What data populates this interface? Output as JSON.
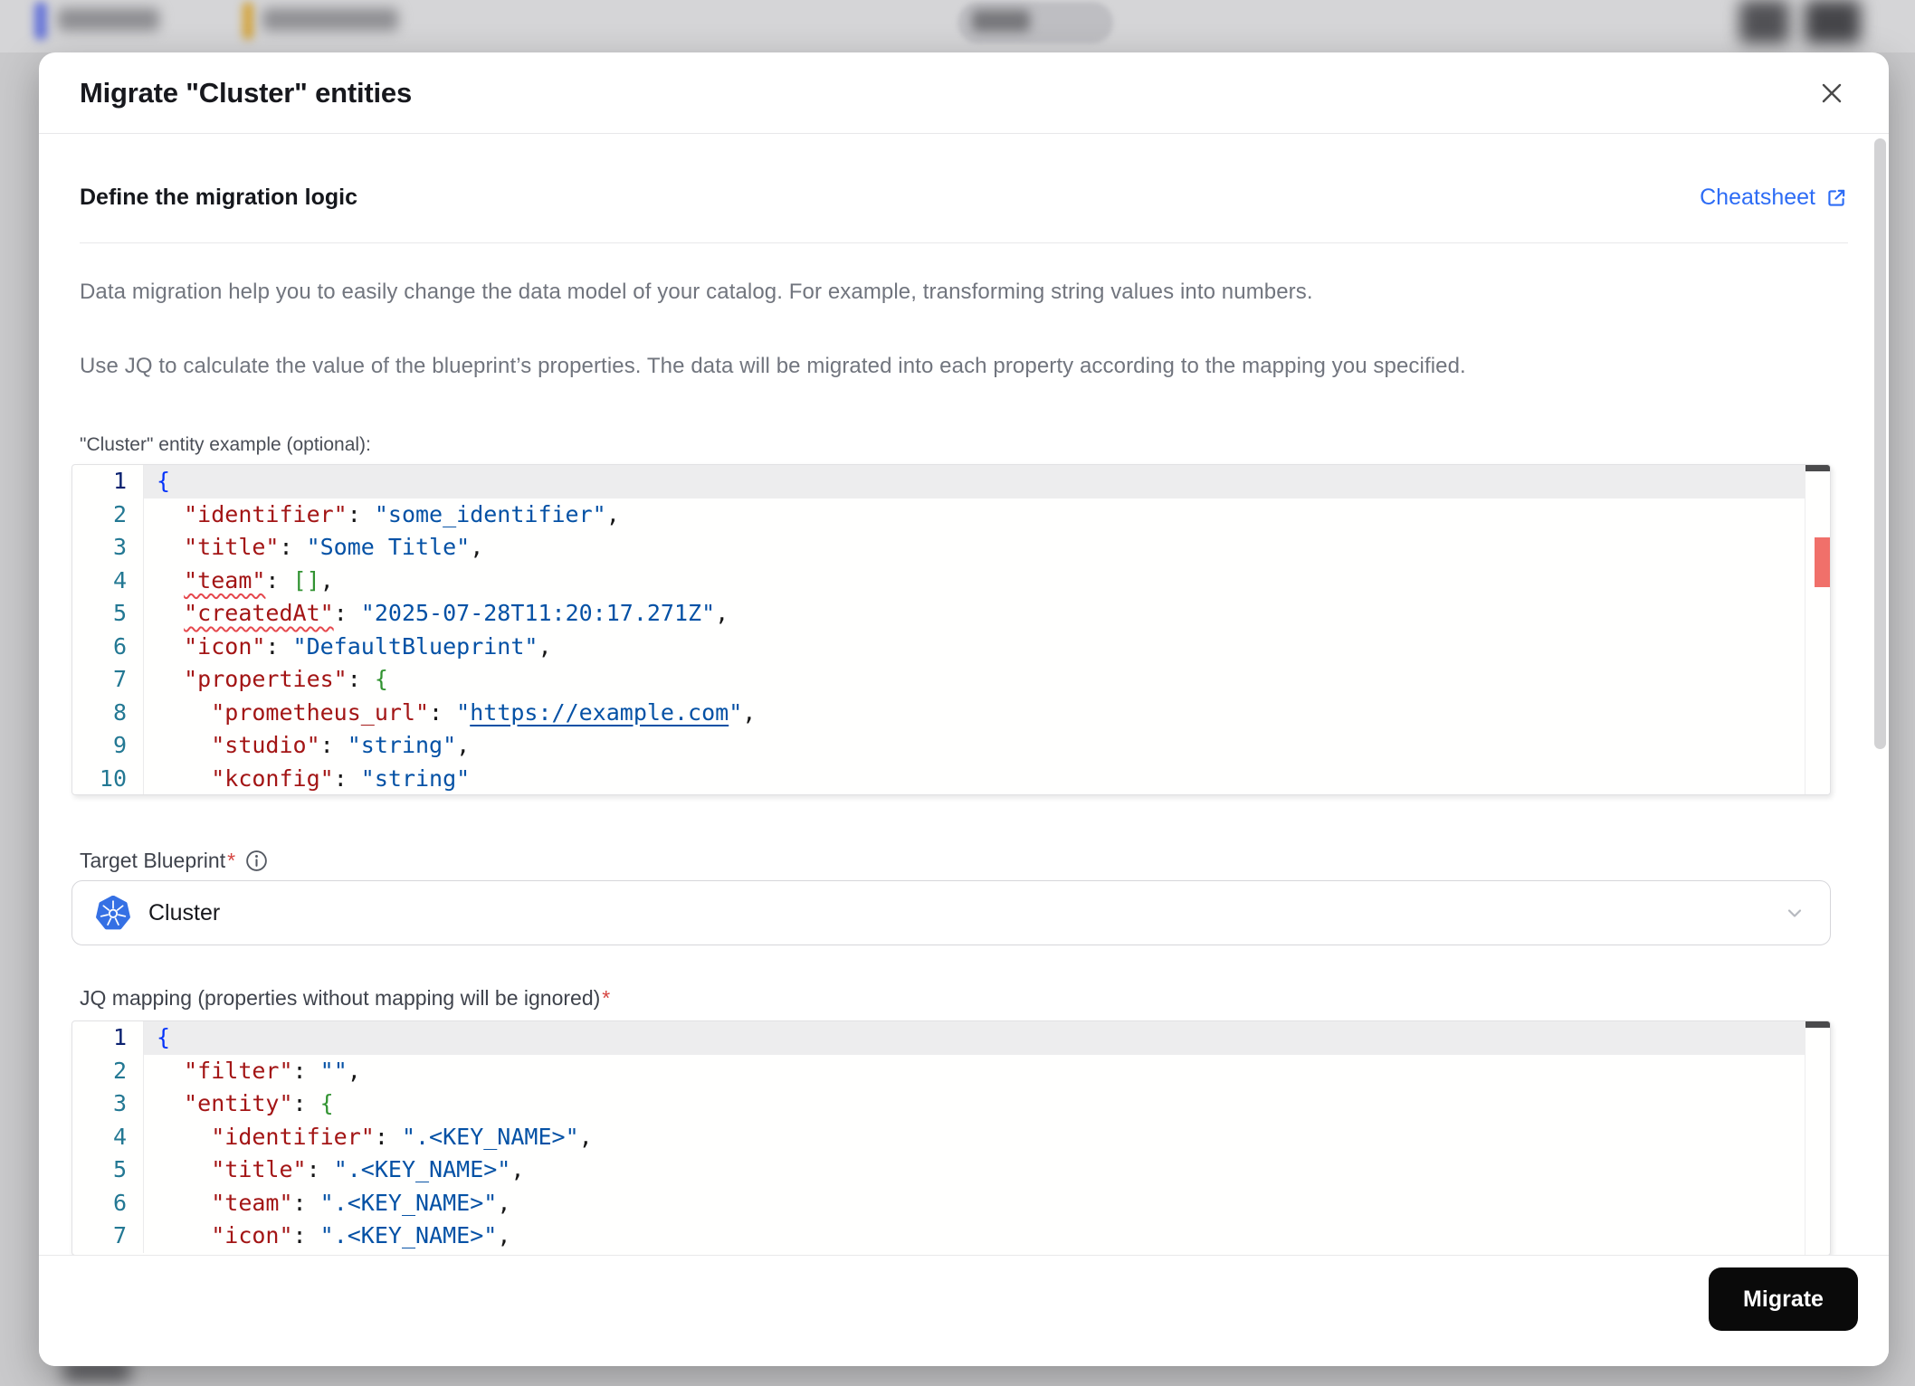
{
  "modal": {
    "title": "Migrate \"Cluster\" entities",
    "section": {
      "heading": "Define the migration logic",
      "cheatsheet_label": "Cheatsheet"
    },
    "description": {
      "p1": "Data migration help you to easily change the data model of your catalog. For example, transforming string values into numbers.",
      "p2": "Use JQ to calculate the value of the blueprint’s properties. The data will be migrated into each property according to the mapping you specified."
    },
    "example": {
      "label": "\"Cluster\" entity example (optional):"
    },
    "target_blueprint": {
      "label": "Target Blueprint",
      "required_marker": "*",
      "value": "Cluster"
    },
    "jq_mapping": {
      "label": "JQ mapping (properties without mapping will be ignored)",
      "required_marker": "*"
    },
    "footer": {
      "migrate_label": "Migrate"
    }
  },
  "editors": {
    "example": {
      "lines": [
        {
          "num": 1,
          "active": true,
          "tokens": [
            [
              "b1",
              "{"
            ]
          ]
        },
        {
          "num": 2,
          "active": false,
          "tokens": [
            [
              "p",
              "  "
            ],
            [
              "k",
              "\"identifier\""
            ],
            [
              "p",
              ": "
            ],
            [
              "s",
              "\"some_identifier\""
            ],
            [
              "p",
              ","
            ]
          ]
        },
        {
          "num": 3,
          "active": false,
          "tokens": [
            [
              "p",
              "  "
            ],
            [
              "k",
              "\"title\""
            ],
            [
              "p",
              ": "
            ],
            [
              "s",
              "\"Some Title\""
            ],
            [
              "p",
              ","
            ]
          ]
        },
        {
          "num": 4,
          "active": false,
          "tokens": [
            [
              "p",
              "  "
            ],
            [
              "ks",
              "\"team\""
            ],
            [
              "p",
              ": "
            ],
            [
              "b2",
              "[]"
            ],
            [
              "p",
              ","
            ]
          ]
        },
        {
          "num": 5,
          "active": false,
          "tokens": [
            [
              "p",
              "  "
            ],
            [
              "ks",
              "\"createdAt\""
            ],
            [
              "p",
              ": "
            ],
            [
              "s",
              "\"2025-07-28T11:20:17.271Z\""
            ],
            [
              "p",
              ","
            ]
          ]
        },
        {
          "num": 6,
          "active": false,
          "tokens": [
            [
              "p",
              "  "
            ],
            [
              "k",
              "\"icon\""
            ],
            [
              "p",
              ": "
            ],
            [
              "s",
              "\"DefaultBlueprint\""
            ],
            [
              "p",
              ","
            ]
          ]
        },
        {
          "num": 7,
          "active": false,
          "tokens": [
            [
              "p",
              "  "
            ],
            [
              "k",
              "\"properties\""
            ],
            [
              "p",
              ": "
            ],
            [
              "b2",
              "{"
            ]
          ]
        },
        {
          "num": 8,
          "active": false,
          "tokens": [
            [
              "p",
              "    "
            ],
            [
              "k",
              "\"prometheus_url\""
            ],
            [
              "p",
              ": "
            ],
            [
              "s",
              "\""
            ],
            [
              "ln",
              "https://example.com"
            ],
            [
              "s",
              "\""
            ],
            [
              "p",
              ","
            ]
          ]
        },
        {
          "num": 9,
          "active": false,
          "tokens": [
            [
              "p",
              "    "
            ],
            [
              "k",
              "\"studio\""
            ],
            [
              "p",
              ": "
            ],
            [
              "s",
              "\"string\""
            ],
            [
              "p",
              ","
            ]
          ]
        },
        {
          "num": 10,
          "active": false,
          "tokens": [
            [
              "p",
              "    "
            ],
            [
              "k",
              "\"kconfig\""
            ],
            [
              "p",
              ": "
            ],
            [
              "s",
              "\"string\""
            ]
          ]
        }
      ]
    },
    "jq": {
      "lines": [
        {
          "num": 1,
          "active": true,
          "tokens": [
            [
              "b1",
              "{"
            ]
          ]
        },
        {
          "num": 2,
          "active": false,
          "tokens": [
            [
              "p",
              "  "
            ],
            [
              "k",
              "\"filter\""
            ],
            [
              "p",
              ": "
            ],
            [
              "s",
              "\"\""
            ],
            [
              "p",
              ","
            ]
          ]
        },
        {
          "num": 3,
          "active": false,
          "tokens": [
            [
              "p",
              "  "
            ],
            [
              "k",
              "\"entity\""
            ],
            [
              "p",
              ": "
            ],
            [
              "b2",
              "{"
            ]
          ]
        },
        {
          "num": 4,
          "active": false,
          "tokens": [
            [
              "p",
              "    "
            ],
            [
              "k",
              "\"identifier\""
            ],
            [
              "p",
              ": "
            ],
            [
              "s",
              "\".<KEY_NAME>\""
            ],
            [
              "p",
              ","
            ]
          ]
        },
        {
          "num": 5,
          "active": false,
          "tokens": [
            [
              "p",
              "    "
            ],
            [
              "k",
              "\"title\""
            ],
            [
              "p",
              ": "
            ],
            [
              "s",
              "\".<KEY_NAME>\""
            ],
            [
              "p",
              ","
            ]
          ]
        },
        {
          "num": 6,
          "active": false,
          "tokens": [
            [
              "p",
              "    "
            ],
            [
              "k",
              "\"team\""
            ],
            [
              "p",
              ": "
            ],
            [
              "s",
              "\".<KEY_NAME>\""
            ],
            [
              "p",
              ","
            ]
          ]
        },
        {
          "num": 7,
          "active": false,
          "tokens": [
            [
              "p",
              "    "
            ],
            [
              "k",
              "\"icon\""
            ],
            [
              "p",
              ": "
            ],
            [
              "s",
              "\".<KEY_NAME>\""
            ],
            [
              "p",
              ","
            ]
          ]
        }
      ]
    }
  },
  "icons": {
    "close": "close-icon",
    "external_link": "external-link-icon",
    "info": "info-icon",
    "kubernetes": "kubernetes-icon",
    "chevron_down": "chevron-down-icon"
  },
  "colors": {
    "accent_blue": "#2d6cf5",
    "button_bg": "#0a0a0a",
    "kubernetes_blue": "#3570e4",
    "required_red": "#d64541",
    "code_key": "#a31515",
    "code_string": "#0451a5",
    "code_bracket_1": "#0433fa",
    "code_bracket_2": "#319331",
    "line_number": "#237893",
    "line_number_active": "#0b216f",
    "error_red": "#e5484d",
    "overview_marker": "#f0706a"
  }
}
